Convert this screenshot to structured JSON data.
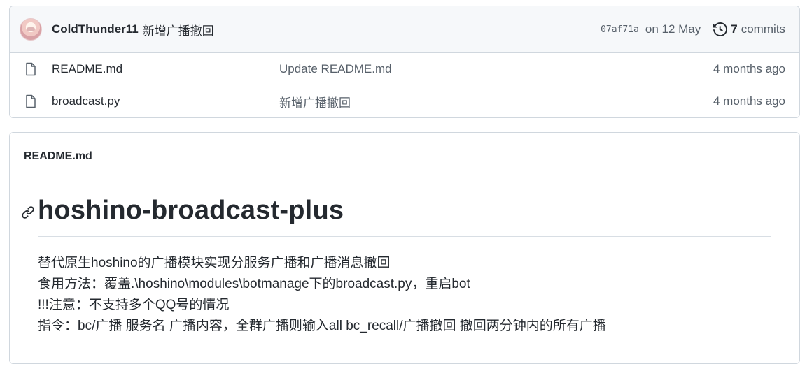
{
  "latest_commit": {
    "author": "ColdThunder11",
    "message": "新增广播撤回",
    "sha": "07af71a",
    "date": "on 12 May",
    "commits_count": "7",
    "commits_label": "commits",
    "history_icon": "history-icon",
    "avatar_icon": "avatar"
  },
  "files": [
    {
      "name": "README.md",
      "message": "Update README.md",
      "age": "4 months ago",
      "icon": "file-icon"
    },
    {
      "name": "broadcast.py",
      "message": "新增广播撤回",
      "age": "4 months ago",
      "icon": "file-icon"
    }
  ],
  "readme": {
    "header": "README.md",
    "title": "hoshino-broadcast-plus",
    "anchor_icon": "link-icon",
    "lines": [
      "替代原生hoshino的广播模块实现分服务广播和广播消息撤回",
      "食用方法：覆盖.\\hoshino\\modules\\botmanage下的broadcast.py，重启bot",
      "!!!注意：不支持多个QQ号的情况",
      "指令：bc/广播 服务名 广播内容，全群广播则输入all bc_recall/广播撤回 撤回两分钟内的所有广播"
    ]
  }
}
